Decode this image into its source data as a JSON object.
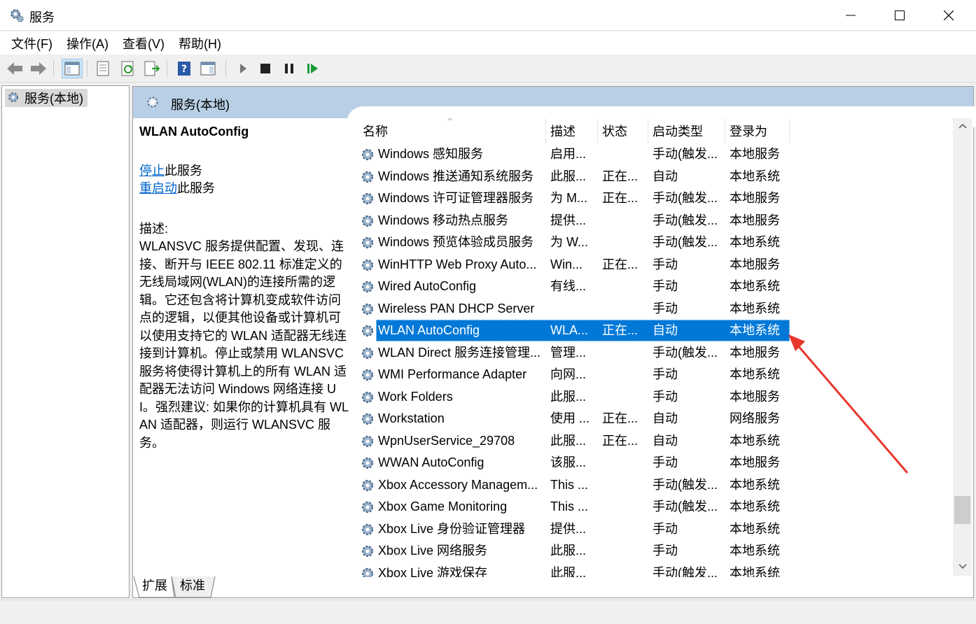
{
  "window": {
    "title": "服务"
  },
  "menu": {
    "items": [
      "文件(F)",
      "操作(A)",
      "查看(V)",
      "帮助(H)"
    ]
  },
  "tree": {
    "root_label": "服务(本地)"
  },
  "panel": {
    "header_title": "服务(本地)"
  },
  "description": {
    "service_name": "WLAN AutoConfig",
    "stop_link": "停止",
    "stop_suffix": "此服务",
    "restart_link": "重启动",
    "restart_suffix": "此服务",
    "label": "描述:",
    "text": "WLANSVC 服务提供配置、发现、连接、断开与 IEEE 802.11 标准定义的无线局域网(WLAN)的连接所需的逻辑。它还包含将计算机变成软件访问点的逻辑，以便其他设备或计算机可以使用支持它的 WLAN 适配器无线连接到计算机。停止或禁用 WLANSVC 服务将使得计算机上的所有 WLAN 适配器无法访问 Windows 网络连接 UI。强烈建议: 如果你的计算机具有 WLAN 适配器，则运行 WLANSVC 服务。"
  },
  "columns": {
    "name": "名称",
    "desc": "描述",
    "status": "状态",
    "startup": "启动类型",
    "logon": "登录为"
  },
  "services": [
    {
      "name": "Windows 感知服务",
      "desc": "启用...",
      "status": "",
      "startup": "手动(触发...",
      "logon": "本地服务"
    },
    {
      "name": "Windows 推送通知系统服务",
      "desc": "此服...",
      "status": "正在...",
      "startup": "自动",
      "logon": "本地系统"
    },
    {
      "name": "Windows 许可证管理器服务",
      "desc": "为 M...",
      "status": "正在...",
      "startup": "手动(触发...",
      "logon": "本地服务"
    },
    {
      "name": "Windows 移动热点服务",
      "desc": "提供...",
      "status": "",
      "startup": "手动(触发...",
      "logon": "本地服务"
    },
    {
      "name": "Windows 预览体验成员服务",
      "desc": "为 W...",
      "status": "",
      "startup": "手动(触发...",
      "logon": "本地系统"
    },
    {
      "name": "WinHTTP Web Proxy Auto...",
      "desc": "Win...",
      "status": "正在...",
      "startup": "手动",
      "logon": "本地服务"
    },
    {
      "name": "Wired AutoConfig",
      "desc": "有线...",
      "status": "",
      "startup": "手动",
      "logon": "本地系统"
    },
    {
      "name": "Wireless PAN DHCP Server",
      "desc": "",
      "status": "",
      "startup": "手动",
      "logon": "本地系统"
    },
    {
      "name": "WLAN AutoConfig",
      "desc": "WLA...",
      "status": "正在...",
      "startup": "自动",
      "logon": "本地系统",
      "selected": true
    },
    {
      "name": "WLAN Direct 服务连接管理...",
      "desc": "管理...",
      "status": "",
      "startup": "手动(触发...",
      "logon": "本地服务"
    },
    {
      "name": "WMI Performance Adapter",
      "desc": "向网...",
      "status": "",
      "startup": "手动",
      "logon": "本地系统"
    },
    {
      "name": "Work Folders",
      "desc": "此服...",
      "status": "",
      "startup": "手动",
      "logon": "本地服务"
    },
    {
      "name": "Workstation",
      "desc": "使用 ...",
      "status": "正在...",
      "startup": "自动",
      "logon": "网络服务"
    },
    {
      "name": "WpnUserService_29708",
      "desc": "此服...",
      "status": "正在...",
      "startup": "自动",
      "logon": "本地系统"
    },
    {
      "name": "WWAN AutoConfig",
      "desc": "该服...",
      "status": "",
      "startup": "手动",
      "logon": "本地服务"
    },
    {
      "name": "Xbox Accessory Managem...",
      "desc": "This ...",
      "status": "",
      "startup": "手动(触发...",
      "logon": "本地系统"
    },
    {
      "name": "Xbox Game Monitoring",
      "desc": "This ...",
      "status": "",
      "startup": "手动(触发...",
      "logon": "本地系统"
    },
    {
      "name": "Xbox Live 身份验证管理器",
      "desc": "提供...",
      "status": "",
      "startup": "手动",
      "logon": "本地系统"
    },
    {
      "name": "Xbox Live 网络服务",
      "desc": "此服...",
      "status": "",
      "startup": "手动",
      "logon": "本地系统"
    },
    {
      "name": "Xbox Live 游戏保存",
      "desc": "此服...",
      "status": "",
      "startup": "手动(触发...",
      "logon": "本地系统"
    }
  ],
  "tabs": [
    "扩展",
    "标准"
  ],
  "colors": {
    "selection": "#0078d7",
    "header_band": "#b8cfe5",
    "link": "#0066cc",
    "annotation_arrow": "#e8382e"
  }
}
